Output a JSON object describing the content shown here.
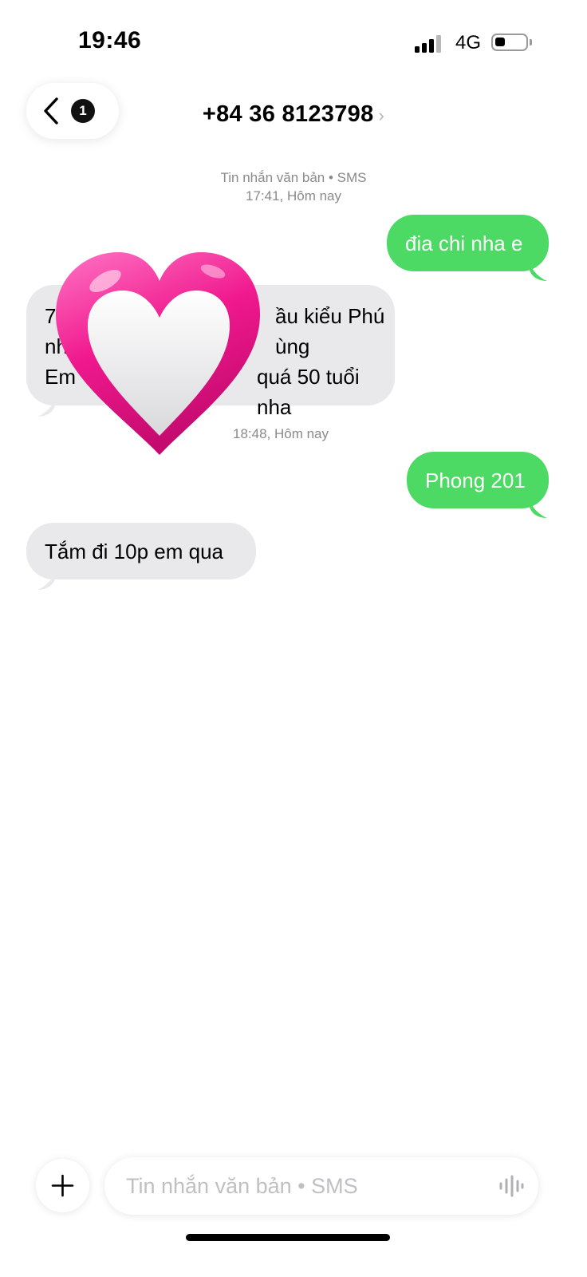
{
  "status_bar": {
    "time": "19:46",
    "network": "4G"
  },
  "header": {
    "unread_count": "1",
    "contact": "+84 36 8123798",
    "chevron": "›"
  },
  "thread": {
    "meta_1": {
      "line1": "Tin nhắn văn bản • SMS",
      "line2": "17:41, Hôm nay"
    },
    "msg_out_1": "đia chi nha e",
    "msg_in_1": {
      "line1": "7",
      "line1_tail": "ầu kiểu Phú",
      "line2": "nh",
      "line2_tail": "ùng",
      "line3": "Em",
      "line3_tail": "quá 50 tuổi nha"
    },
    "meta_2": "18:48, Hôm nay",
    "msg_out_2": "Phong 201",
    "msg_in_2": "Tắm đi 10p em qua"
  },
  "composer": {
    "placeholder": "Tin nhắn văn bản • SMS"
  },
  "colors": {
    "outgoing": "#4cd964",
    "incoming": "#e9e9eb",
    "heart": "#ee1c8c"
  },
  "icons": [
    "chevron-left-icon",
    "plus-icon",
    "waveform-icon",
    "heart-sticker"
  ]
}
